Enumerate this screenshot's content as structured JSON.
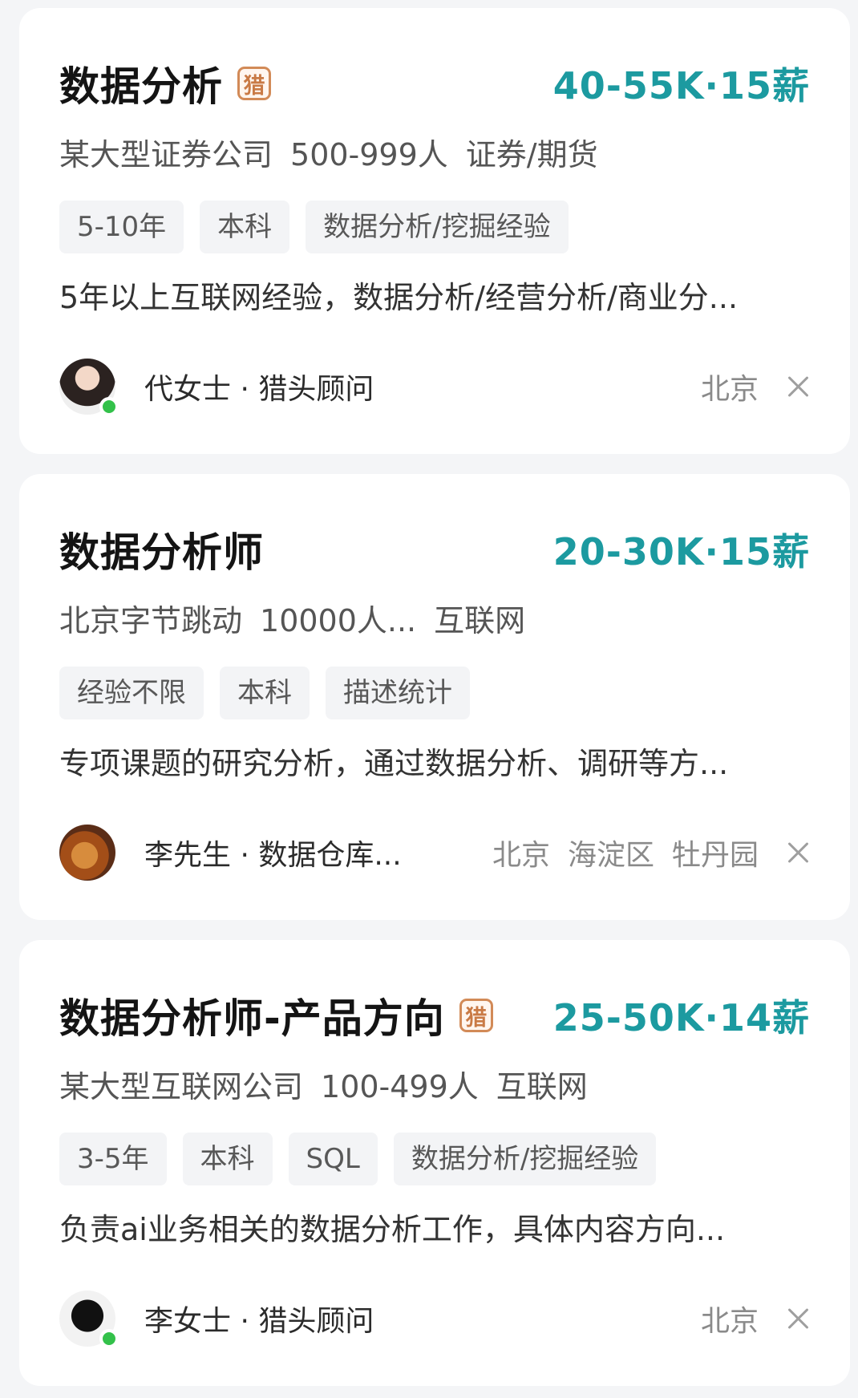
{
  "jobs": [
    {
      "title": "数据分析",
      "hunter_badge": "猎",
      "salary": "40-55K·15薪",
      "company": "某大型证券公司",
      "size": "500-999人",
      "industry": "证券/期货",
      "tags": [
        "5-10年",
        "本科",
        "数据分析/挖掘经验"
      ],
      "description": "5年以上互联网经验，数据分析/经营分析/商业分...",
      "recruiter": "代女士 · 猎头顾问",
      "location": [
        "北京"
      ]
    },
    {
      "title": "数据分析师",
      "hunter_badge": "",
      "salary": "20-30K·15薪",
      "company": "北京字节跳动",
      "size": "10000人...",
      "industry": "互联网",
      "tags": [
        "经验不限",
        "本科",
        "描述统计"
      ],
      "description": "专项课题的研究分析，通过数据分析、调研等方...",
      "recruiter": "李先生 · 数据仓库...",
      "location": [
        "北京",
        "海淀区",
        "牡丹园"
      ]
    },
    {
      "title": "数据分析师-产品方向",
      "hunter_badge": "猎",
      "salary": "25-50K·14薪",
      "company": "某大型互联网公司",
      "size": "100-499人",
      "industry": "互联网",
      "tags": [
        "3-5年",
        "本科",
        "SQL",
        "数据分析/挖掘经验"
      ],
      "description": "负责ai业务相关的数据分析工作，具体内容方向...",
      "recruiter": "李女士 · 猎头顾问",
      "location": [
        "北京"
      ]
    }
  ]
}
